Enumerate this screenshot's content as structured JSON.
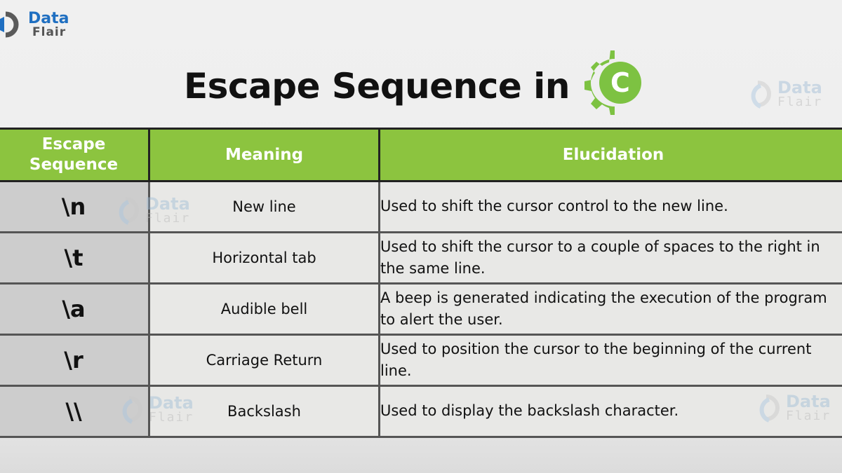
{
  "brand": {
    "name_line1": "Data",
    "name_line2": "Flair",
    "primary_color": "#1f6fc1",
    "accent_color": "#8cc43f"
  },
  "header": {
    "title": "Escape Sequence in",
    "language_icon": "c-gear-icon",
    "language_letter": "C"
  },
  "watermark": {
    "line1": "Data",
    "line2": "Flair"
  },
  "table": {
    "headers": [
      "Escape\nSequence",
      "Meaning",
      "Elucidation"
    ],
    "header_line1": "Escape",
    "header_line2": "Sequence",
    "rows": [
      {
        "sequence": "\\n",
        "meaning": "New line",
        "elucidation": "Used to shift the cursor control to the new line."
      },
      {
        "sequence": "\\t",
        "meaning": "Horizontal tab",
        "elucidation": "Used to shift the cursor to a couple of spaces to the right in the same line."
      },
      {
        "sequence": "\\a",
        "meaning": "Audible bell",
        "elucidation": "A beep is generated indicating the execution of the program to alert the user."
      },
      {
        "sequence": "\\r",
        "meaning": "Carriage Return",
        "elucidation": "Used to position the cursor to the beginning of the current line."
      },
      {
        "sequence": "\\\\",
        "meaning": "Backslash",
        "elucidation": "Used to display the backslash character."
      }
    ]
  }
}
